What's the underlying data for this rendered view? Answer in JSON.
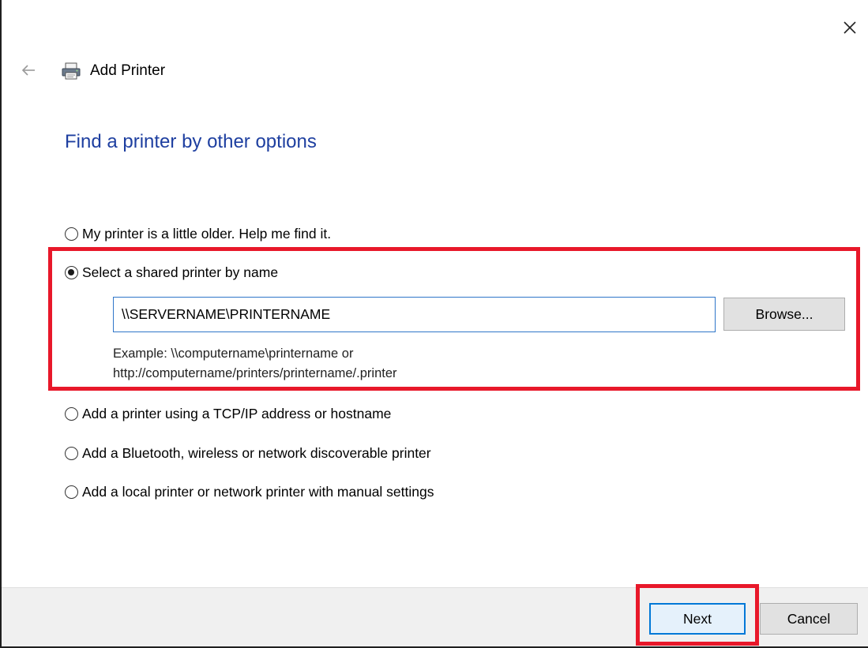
{
  "window": {
    "title": "Add Printer",
    "close_icon": "close-icon",
    "back_icon": "back-arrow-icon",
    "printer_icon": "printer-icon"
  },
  "page": {
    "heading": "Find a printer by other options"
  },
  "options": [
    {
      "label": "My printer is a little older. Help me find it.",
      "selected": false
    },
    {
      "label": "Select a shared printer by name",
      "selected": true
    },
    {
      "label": "Add a printer using a TCP/IP address or hostname",
      "selected": false
    },
    {
      "label": "Add a Bluetooth, wireless or network discoverable printer",
      "selected": false
    },
    {
      "label": "Add a local printer or network printer with manual settings",
      "selected": false
    }
  ],
  "shared_printer": {
    "value": "\\\\SERVERNAME\\PRINTERNAME",
    "browse_label": "Browse...",
    "example_line1": "Example: \\\\computername\\printername or",
    "example_line2": "http://computername/printers/printername/.printer"
  },
  "footer": {
    "next_label": "Next",
    "cancel_label": "Cancel"
  },
  "colors": {
    "heading": "#1e3fa0",
    "highlight": "#e8182a",
    "focus": "#0078d7"
  }
}
